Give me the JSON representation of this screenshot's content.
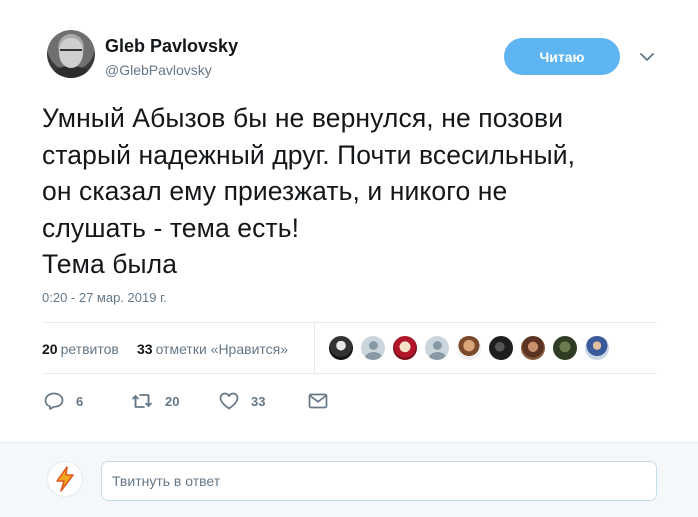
{
  "author": {
    "name": "Gleb Pavlovsky",
    "handle": "@GlebPavlovsky"
  },
  "follow_button": {
    "label": "Читаю"
  },
  "tweet": {
    "text": "Умный Абызов бы не вернулся, не позови\nстарый надежный друг.  Почти всесильный,\nон сказал ему приезжать, и никого не\nслушать - тема есть!\nТема была",
    "timestamp": "0:20 - 27 мар. 2019 г."
  },
  "stats": {
    "retweets_count": "20",
    "retweets_label": "ретвитов",
    "likes_count": "33",
    "likes_label": "отметки «Нравится»",
    "likers": [
      "user-avatar-1",
      "default-avatar",
      "mask-avatar",
      "default-avatar",
      "user-avatar-5",
      "user-avatar-6",
      "user-avatar-7",
      "user-avatar-8",
      "user-avatar-9"
    ]
  },
  "actions": {
    "reply_count": "6",
    "retweet_count": "20",
    "like_count": "33",
    "icons": [
      "reply-icon",
      "retweet-icon",
      "like-icon",
      "direct-message-icon"
    ]
  },
  "reply": {
    "placeholder": "Твитнуть в ответ"
  },
  "colors": {
    "accent": "#1da1f2",
    "follow_button": "#5fb5f1",
    "secondary_text": "#657786",
    "divider": "#e6ecf0"
  }
}
